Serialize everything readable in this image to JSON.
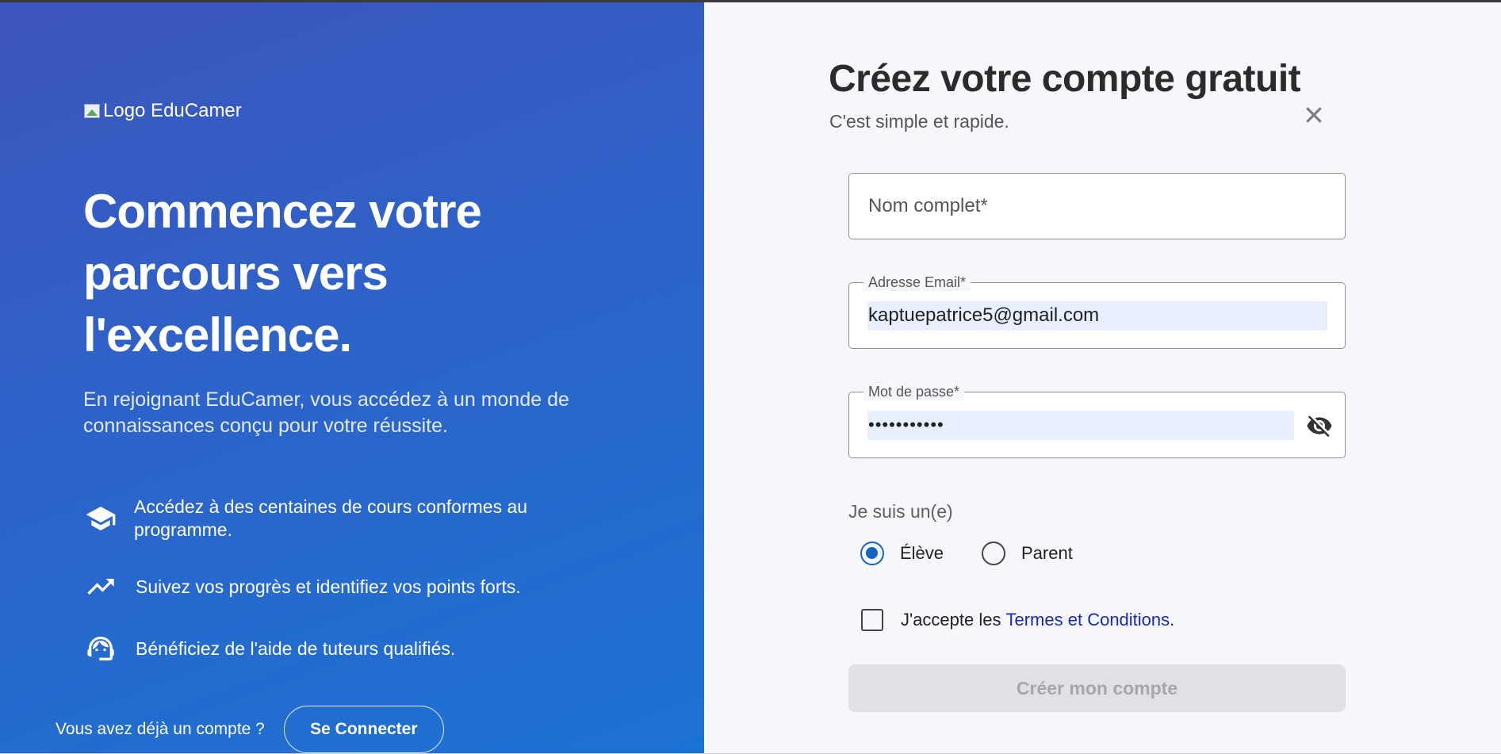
{
  "hero": {
    "logo_alt": "Logo EduCamer",
    "headline": "Commencez votre parcours vers l'excellence.",
    "lead": "En rejoignant EduCamer, vous accédez à un monde de connaissances conçu pour votre réussite.",
    "features": [
      {
        "icon": "graduation-cap-icon",
        "text": "Accédez à des centaines de cours conformes au programme."
      },
      {
        "icon": "trending-up-icon",
        "text": "Suivez vos progrès et identifiez vos points forts."
      },
      {
        "icon": "support-agent-icon",
        "text": "Bénéficiez de l'aide de tuteurs qualifiés."
      }
    ],
    "signin_prompt": "Vous avez déjà un compte ?",
    "signin_button": "Se Connecter"
  },
  "form": {
    "title": "Créez votre compte gratuit",
    "subtitle": "C'est simple et rapide.",
    "name_placeholder": "Nom complet*",
    "email_label": "Adresse Email*",
    "email_value": "kaptuepatrice5@gmail.com",
    "password_label": "Mot de passe*",
    "password_value": "•••••••••••",
    "role_label": "Je suis un(e)",
    "roles": [
      {
        "label": "Élève",
        "selected": true
      },
      {
        "label": "Parent",
        "selected": false
      }
    ],
    "terms_prefix": "J'accepte les",
    "terms_link": "Termes et Conditions",
    "terms_suffix": ".",
    "terms_checked": false,
    "submit_label": "Créer mon compte",
    "submit_enabled": false
  },
  "colors": {
    "hero_gradient_start": "#3d54bc",
    "hero_gradient_end": "#1c73d3",
    "panel_background": "#f6f7fb",
    "accent": "#1565c0",
    "link": "#1a28b8",
    "autofill": "#e8f0fe"
  }
}
